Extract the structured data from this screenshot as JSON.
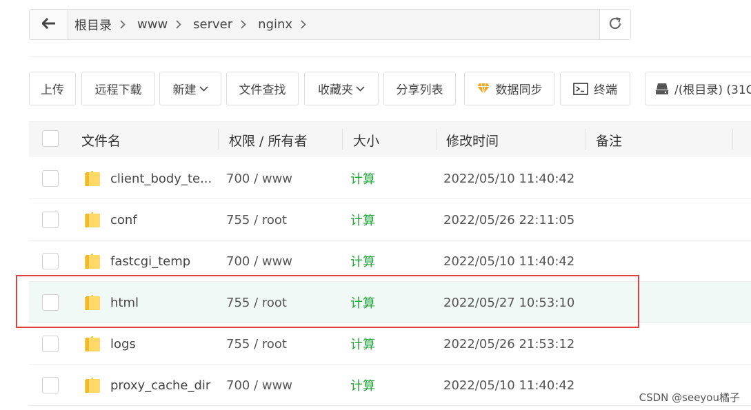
{
  "path": {
    "crumbs": [
      "根目录",
      "www",
      "server",
      "nginx"
    ]
  },
  "toolbar": {
    "upload": "上传",
    "remote_download": "远程下载",
    "new": "新建",
    "search": "文件查找",
    "favorites": "收藏夹",
    "share_list": "分享列表",
    "sync": "数据同步",
    "terminal": "终端",
    "disk": "/(根目录) (31G"
  },
  "table": {
    "headers": {
      "name": "文件名",
      "perm": "权限 / 所有者",
      "size": "大小",
      "mtime": "修改时间",
      "note": "备注"
    },
    "rows": [
      {
        "name": "client_body_te...",
        "perm": "700 / www",
        "size": "计算",
        "mtime": "2022/05/10 11:40:42"
      },
      {
        "name": "conf",
        "perm": "755 / root",
        "size": "计算",
        "mtime": "2022/05/26 22:11:05"
      },
      {
        "name": "fastcgi_temp",
        "perm": "700 / www",
        "size": "计算",
        "mtime": "2022/05/10 11:40:42"
      },
      {
        "name": "html",
        "perm": "755 / root",
        "size": "计算",
        "mtime": "2022/05/27 10:53:10"
      },
      {
        "name": "logs",
        "perm": "755 / root",
        "size": "计算",
        "mtime": "2022/05/26 21:53:12"
      },
      {
        "name": "proxy_cache_dir",
        "perm": "700 / www",
        "size": "计算",
        "mtime": "2022/05/10 11:40:42"
      }
    ]
  },
  "watermark": "CSDN @seeyou橘子",
  "colors": {
    "accent_green": "#20a53a",
    "highlight_border": "#e23f3f",
    "folder": "#f5c43b"
  }
}
